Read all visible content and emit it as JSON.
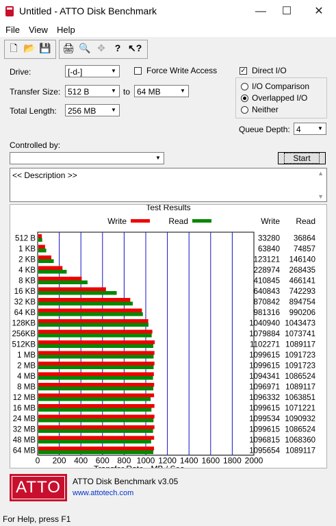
{
  "window": {
    "title": "Untitled - ATTO Disk Benchmark",
    "minimize": "—",
    "maximize": "☐",
    "close": "✕"
  },
  "menu": [
    "File",
    "View",
    "Help"
  ],
  "toolbar": {
    "icons": [
      "new-icon",
      "open-icon",
      "save-icon",
      "print-icon",
      "print-preview-icon",
      "move-icon",
      "help-icon",
      "context-help-icon"
    ],
    "glyphs": [
      "🗋",
      "📂",
      "💾",
      "🖨",
      "🔍",
      "✥",
      "?",
      "↖?"
    ]
  },
  "form": {
    "drive_label": "Drive:",
    "drive_value": "[-d-]",
    "force_write_label": "Force Write Access",
    "direct_io_label": "Direct I/O",
    "direct_io_checked": true,
    "transfer_label": "Transfer Size:",
    "transfer_from": "512 B",
    "to_label": "to",
    "transfer_to": "64 MB",
    "total_label": "Total Length:",
    "total_value": "256 MB",
    "io_options": [
      "I/O Comparison",
      "Overlapped I/O",
      "Neither"
    ],
    "io_selected": 1,
    "queue_label": "Queue Depth:",
    "queue_value": "4",
    "controlled_label": "Controlled by:",
    "controlled_value": "",
    "start_label": "Start",
    "description": "<< Description >>"
  },
  "results": {
    "title": "Test Results",
    "write_legend": "Write",
    "read_legend": "Read",
    "write_header": "Write",
    "read_header": "Read",
    "write_color": "#ee0000",
    "read_color": "#008800",
    "x_axis_label": "Transfer Rate - MB / Sec"
  },
  "chart_data": {
    "type": "bar",
    "orientation": "horizontal",
    "title": "Test Results",
    "xlabel": "Transfer Rate - MB / Sec",
    "xlim": [
      0,
      2000
    ],
    "xticks": [
      0,
      200,
      400,
      600,
      800,
      1000,
      1200,
      1400,
      1600,
      1800,
      2000
    ],
    "categories": [
      "512 B",
      "1 KB",
      "2 KB",
      "4 KB",
      "8 KB",
      "16 KB",
      "32 KB",
      "64 KB",
      "128KB",
      "256KB",
      "512KB",
      "1 MB",
      "2 MB",
      "4 MB",
      "8 MB",
      "12 MB",
      "16 MB",
      "24 MB",
      "32 MB",
      "48 MB",
      "64 MB"
    ],
    "series": [
      {
        "name": "Write",
        "values": [
          33280,
          63840,
          123121,
          228974,
          410845,
          640843,
          870842,
          981316,
          1040940,
          1079884,
          1102271,
          1099615,
          1099615,
          1094341,
          1096971,
          1096332,
          1099615,
          1099534,
          1099615,
          1096815,
          1095654
        ]
      },
      {
        "name": "Read",
        "values": [
          36864,
          74857,
          146140,
          268435,
          466141,
          742293,
          894754,
          990206,
          1043473,
          1073741,
          1089117,
          1091723,
          1091723,
          1086524,
          1089117,
          1063851,
          1071221,
          1090932,
          1086524,
          1068360,
          1089117
        ]
      }
    ]
  },
  "footer": {
    "product": "ATTO Disk Benchmark v3.05",
    "url": "www.attotech.com",
    "logo": "ATTO"
  },
  "status": "For Help, press F1"
}
